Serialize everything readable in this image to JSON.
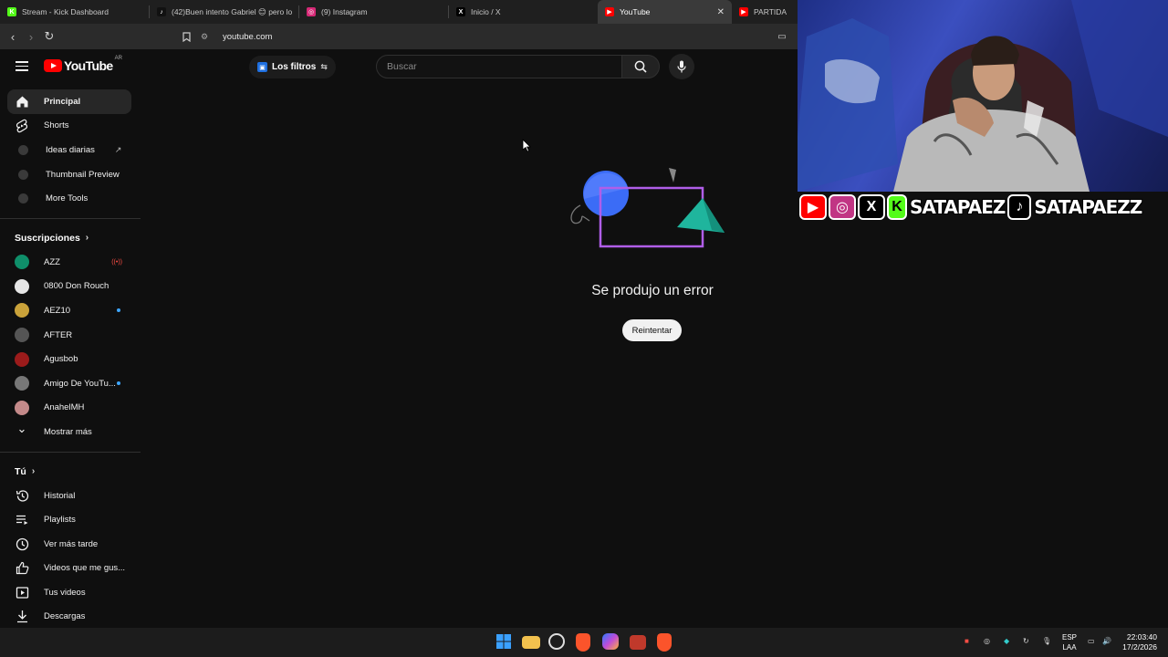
{
  "browser": {
    "tabs": [
      {
        "title": "Stream - Kick Dashboard",
        "icon": "kick-icon",
        "color": "#53fc18",
        "glyph": "K"
      },
      {
        "title": "(42)Buen intento Gabriel 😊 pero lo",
        "icon": "tiktok-icon",
        "color": "#111111",
        "glyph": "♪"
      },
      {
        "title": "(9) Instagram",
        "icon": "instagram-icon",
        "color": "#d62976",
        "glyph": "◎"
      },
      {
        "title": "Inicio / X",
        "icon": "x-icon",
        "color": "#000000",
        "glyph": "X"
      },
      {
        "title": "YouTube",
        "icon": "youtube-icon",
        "color": "#ff0000",
        "glyph": "▶",
        "active": true
      },
      {
        "title": "PARTIDAZ",
        "icon": "youtube-icon",
        "color": "#ff0000",
        "glyph": "▶"
      }
    ],
    "url": "youtube.com"
  },
  "youtube": {
    "logo_text": "YouTube",
    "country_code": "AR",
    "filters_label": "Los filtros",
    "search_placeholder": "Buscar",
    "sidebar": {
      "main": [
        {
          "label": "Principal",
          "icon": "home-icon",
          "active": true
        },
        {
          "label": "Shorts",
          "icon": "shorts-icon"
        }
      ],
      "extensions": [
        {
          "label": "Ideas diarias",
          "external": true
        },
        {
          "label": "Thumbnail Preview"
        },
        {
          "label": "More Tools"
        }
      ],
      "subscriptions_title": "Suscripciones",
      "subscriptions": [
        {
          "name": "AZZ",
          "color": "#0f8f6a",
          "indicator": "live"
        },
        {
          "name": "0800 Don Rouch",
          "color": "#e6e6e6"
        },
        {
          "name": "AEZ10",
          "color": "#c9a23a",
          "indicator": "dot"
        },
        {
          "name": "AFTER",
          "color": "#555555"
        },
        {
          "name": "Agusbob",
          "color": "#9b1b1b"
        },
        {
          "name": "Amigo De YouTu...",
          "color": "#777777",
          "indicator": "dot"
        },
        {
          "name": "AnahelMH",
          "color": "#c48a8a"
        }
      ],
      "show_more": "Mostrar más",
      "you_title": "Tú",
      "you_items": [
        {
          "label": "Historial",
          "icon": "history-icon"
        },
        {
          "label": "Playlists",
          "icon": "playlists-icon"
        },
        {
          "label": "Ver más tarde",
          "icon": "watch-later-icon"
        },
        {
          "label": "Videos que me gus...",
          "icon": "like-icon"
        },
        {
          "label": "Tus videos",
          "icon": "your-videos-icon"
        },
        {
          "label": "Descargas",
          "icon": "downloads-icon"
        }
      ]
    },
    "error_message": "Se produjo un error",
    "retry_label": "Reintentar"
  },
  "overlay": {
    "handle_1": "SATAPAEZ",
    "handle_2": "SATAPAEZZ"
  },
  "taskbar": {
    "language": "ESP",
    "layout": "LAA",
    "time": "22:03:40",
    "date": "17/2/2026"
  }
}
